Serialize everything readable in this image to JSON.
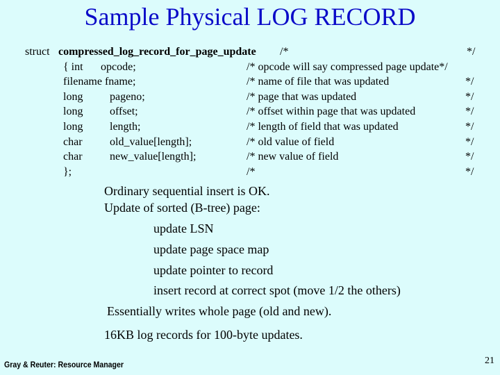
{
  "slide": {
    "title": "Sample Physical LOG RECORD",
    "struct": {
      "keyword": "struct",
      "name": "compressed_log_record_for_page_update",
      "header_comment_open": "/*",
      "header_comment_close": "*/",
      "fields": [
        {
          "type": "{ int",
          "name": "opcode;",
          "comment": "/* opcode will say compressed page update*/",
          "comment_close": ""
        },
        {
          "type": "filename fname;",
          "name": "",
          "comment": "/* name of file that was updated",
          "comment_close": "*/"
        },
        {
          "type": "long",
          "name": "pageno;",
          "comment": "/* page that was updated",
          "comment_close": "*/"
        },
        {
          "type": "long",
          "name": "offset;",
          "comment": "/* offset within page that was updated",
          "comment_close": "*/"
        },
        {
          "type": "long",
          "name": "length;",
          "comment": "/* length of field that was updated",
          "comment_close": "*/"
        },
        {
          "type": "char",
          "name": "old_value[length];",
          "comment": "/* old value of field",
          "comment_close": "*/"
        },
        {
          "type": "char",
          "name": "new_value[length];",
          "comment": "/* new value of field",
          "comment_close": "*/"
        },
        {
          "type": "};",
          "name": "",
          "comment": "/*",
          "comment_close": "*/"
        }
      ]
    },
    "notes": [
      "Ordinary sequential insert is OK.",
      "Update of sorted (B-tree) page:",
      "update LSN",
      "update page space map",
      "update pointer to record",
      "insert record at correct spot (move 1/2 the others)",
      "Essentially writes whole page (old and new).",
      "16KB log records for 100-byte updates."
    ],
    "footer": {
      "source": "Gray & Reuter: Resource Manager",
      "page_number": "21"
    },
    "colors": {
      "background": "#dcfcfc",
      "title": "#0a0ac8",
      "text": "#000000"
    }
  }
}
